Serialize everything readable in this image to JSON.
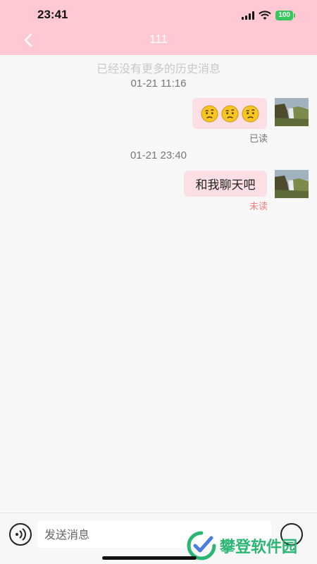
{
  "status_bar": {
    "time": "23:41",
    "battery": "100"
  },
  "nav": {
    "title": "111"
  },
  "chat": {
    "history_tip": "已经没有更多的历史消息",
    "messages": [
      {
        "timestamp": "01-21 11:16",
        "type": "emoji",
        "emoji_icons": [
          "thinking-face-icon",
          "thinking-face-icon",
          "thinking-face-icon"
        ],
        "read_status": "已读"
      },
      {
        "timestamp": "01-21 23:40",
        "type": "text",
        "text": "和我聊天吧",
        "read_status": "未读"
      }
    ]
  },
  "input_bar": {
    "placeholder": "发送消息"
  },
  "watermark": {
    "text": "攀登软件园"
  },
  "colors": {
    "header_bg": "#ffc8d2",
    "bubble_bg": "#fbdfe4",
    "read_color": "#777777",
    "unread_color": "#f07f7f",
    "watermark_green": "#2bb673"
  }
}
